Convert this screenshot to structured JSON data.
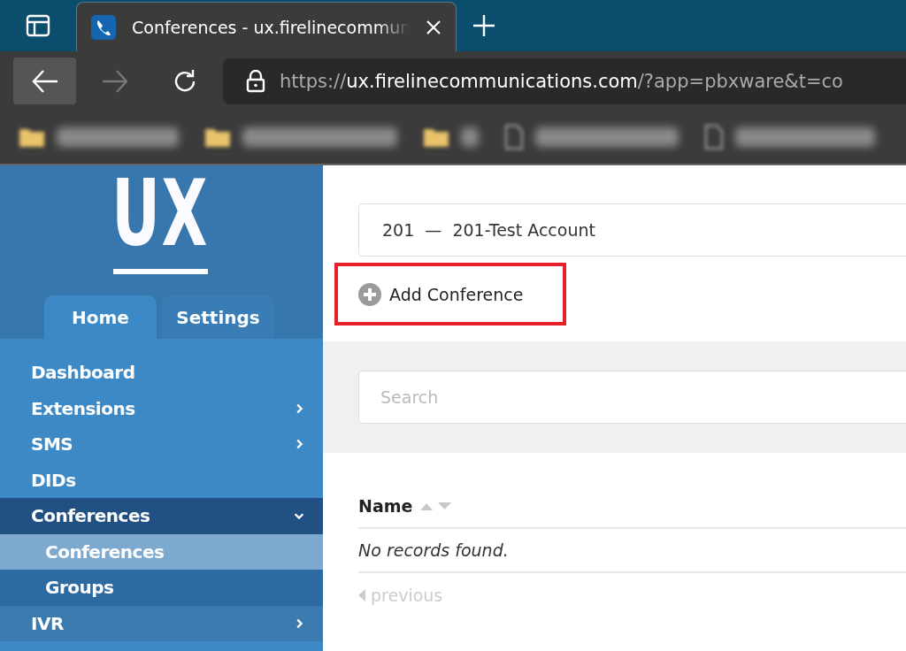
{
  "browser": {
    "tab": {
      "title": "Conferences - ux.firelinecommun",
      "selected": true
    },
    "nav": {
      "back_disabled": false,
      "forward_disabled": true
    },
    "url": {
      "scheme": "https://",
      "host": "ux.firelinecommunications.com",
      "rest": "/?app=pbxware&t=co"
    },
    "bookmarks": [
      {
        "kind": "folder"
      },
      {
        "kind": "folder"
      },
      {
        "kind": "folder"
      },
      {
        "kind": "page"
      },
      {
        "kind": "page"
      }
    ]
  },
  "sidebar": {
    "logo": "UX",
    "tabs": [
      {
        "label": "Home",
        "selected": true
      },
      {
        "label": "Settings",
        "selected": false
      }
    ],
    "items": [
      {
        "label": "Dashboard",
        "expandable": false,
        "expanded": false,
        "selected": false
      },
      {
        "label": "Extensions",
        "expandable": true,
        "expanded": false,
        "selected": false
      },
      {
        "label": "SMS",
        "expandable": true,
        "expanded": false,
        "selected": false
      },
      {
        "label": "DIDs",
        "expandable": false,
        "expanded": false,
        "selected": false
      },
      {
        "label": "Conferences",
        "expandable": true,
        "expanded": true,
        "selected": true,
        "children": [
          {
            "label": "Conferences",
            "selected": true
          },
          {
            "label": "Groups",
            "selected": false
          }
        ]
      },
      {
        "label": "IVR",
        "expandable": true,
        "expanded": false,
        "selected": false
      }
    ]
  },
  "main": {
    "account_select": {
      "value": "201  —  201-Test Account"
    },
    "add_button": {
      "label": "Add Conference",
      "highlighted": true
    },
    "search": {
      "placeholder": "Search"
    },
    "table": {
      "columns": [
        {
          "label": "Name",
          "sortable": true
        }
      ],
      "empty_text": "No records found."
    },
    "pagination": {
      "previous": {
        "label": "previous",
        "disabled": true
      }
    }
  }
}
